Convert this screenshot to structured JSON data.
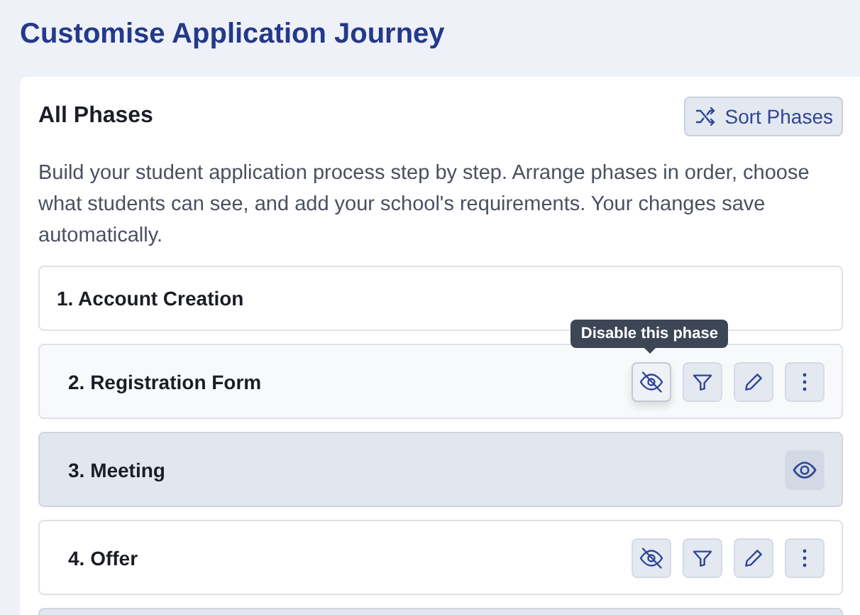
{
  "page": {
    "title": "Customise Application Journey"
  },
  "panel": {
    "heading": "All Phases",
    "sort_button": "Sort Phases",
    "description": "Build your student application process step by step. Arrange phases in order, choose what students can see, and add your school's requirements. Your changes save automatically."
  },
  "phases": [
    {
      "kind": "fixed",
      "label": "1. Account Creation",
      "disabled": false,
      "hovered": false
    },
    {
      "kind": "editable",
      "label": "2. Registration Form",
      "disabled": false,
      "hovered": true,
      "tooltip": "Disable this phase"
    },
    {
      "kind": "editable",
      "label": "3. Meeting",
      "disabled": true,
      "hovered": false
    },
    {
      "kind": "editable",
      "label": "4. Offer",
      "disabled": false,
      "hovered": false
    },
    {
      "kind": "editable",
      "disabled": true,
      "hovered": false
    }
  ]
}
